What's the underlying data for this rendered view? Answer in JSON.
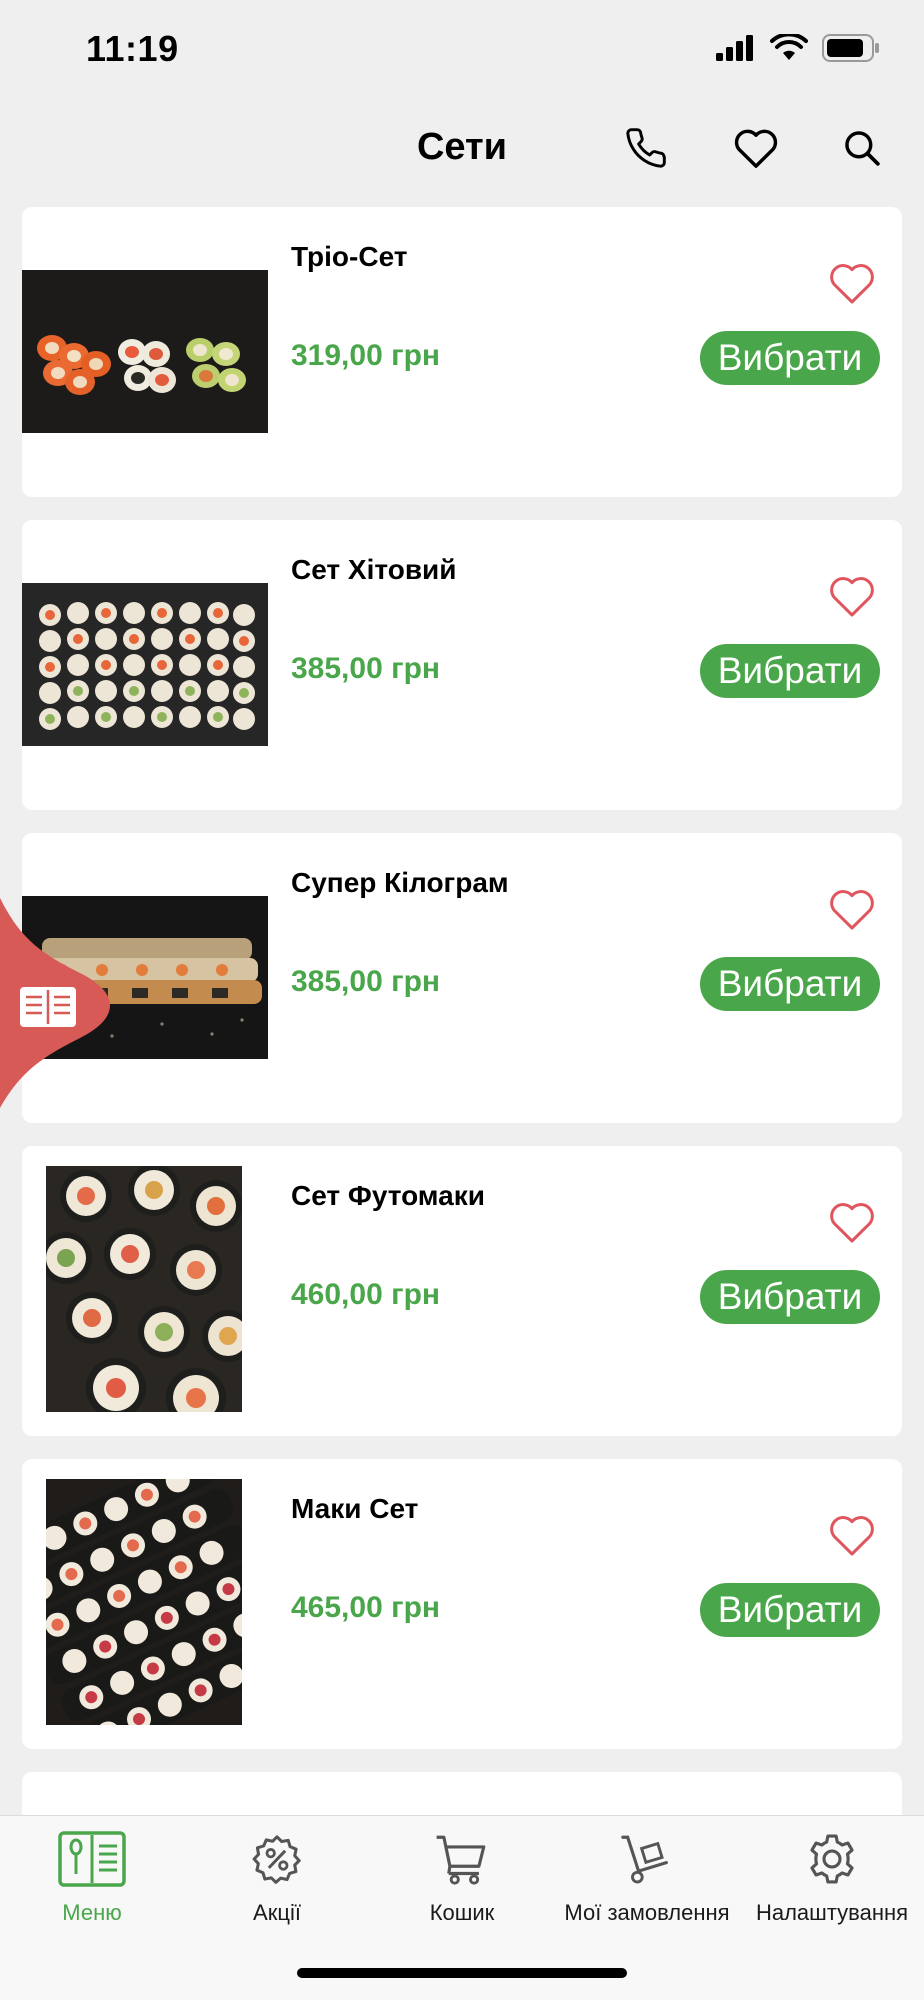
{
  "status": {
    "time": "11:19"
  },
  "header": {
    "title": "Сети"
  },
  "colors": {
    "accent": "#4aa64a",
    "heart": "#e0565f",
    "menu_tab": "#d85a57"
  },
  "icons": [
    "signal-icon",
    "wifi-icon",
    "battery-icon",
    "phone-icon",
    "heart-icon",
    "search-icon",
    "book-menu-icon",
    "percent-gear-icon",
    "cart-icon",
    "hand-truck-icon",
    "gear-icon"
  ],
  "products": [
    {
      "title": "Тріо-Сет",
      "price": "319,00 грн",
      "button": "Вибрати"
    },
    {
      "title": "Сет Хітовий",
      "price": "385,00 грн",
      "button": "Вибрати"
    },
    {
      "title": "Супер Кілограм",
      "price": "385,00 грн",
      "button": "Вибрати"
    },
    {
      "title": "Сет Футомаки",
      "price": "460,00 грн",
      "button": "Вибрати"
    },
    {
      "title": "Маки Сет",
      "price": "465,00 грн",
      "button": "Вибрати"
    }
  ],
  "tabs": [
    {
      "label": "Меню",
      "active": true
    },
    {
      "label": "Акції"
    },
    {
      "label": "Кошик"
    },
    {
      "label": "Мої замовлення"
    },
    {
      "label": "Налаштування"
    }
  ]
}
